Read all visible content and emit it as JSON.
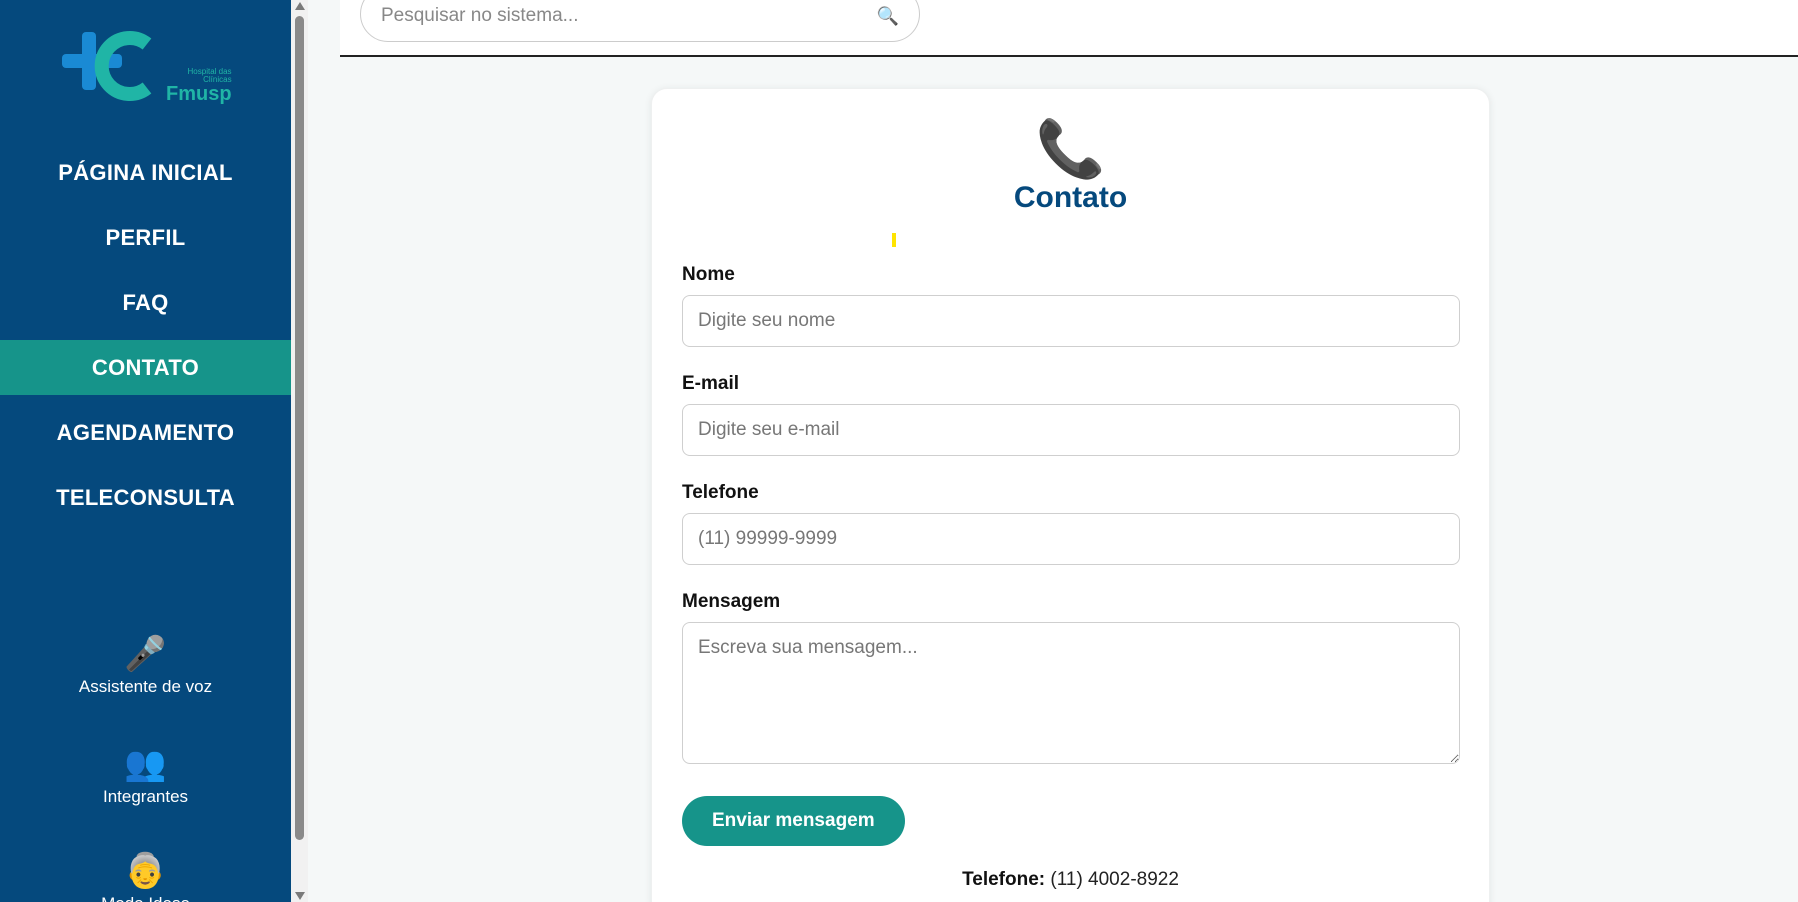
{
  "sidebar": {
    "logo": {
      "small": "Hospital das Clínicas",
      "big": "Fmusp"
    },
    "nav": [
      {
        "label": "PÁGINA INICIAL"
      },
      {
        "label": "PERFIL"
      },
      {
        "label": "FAQ"
      },
      {
        "label": "CONTATO",
        "active": true
      },
      {
        "label": "AGENDAMENTO"
      },
      {
        "label": "TELECONSULTA"
      }
    ],
    "tools": [
      {
        "icon": "microphone-icon",
        "label": "Assistente de voz"
      },
      {
        "icon": "people-icon",
        "label": "Integrantes"
      },
      {
        "icon": "elderly-person-icon",
        "label": "Modo Idoso"
      }
    ]
  },
  "search": {
    "placeholder": "Pesquisar no sistema..."
  },
  "card": {
    "title": "Contato",
    "fields": [
      {
        "label": "Nome",
        "placeholder": "Digite seu nome"
      },
      {
        "label": "E-mail",
        "placeholder": "Digite seu e-mail"
      },
      {
        "label": "Telefone",
        "placeholder": "(11) 99999-9999"
      },
      {
        "label": "Mensagem",
        "placeholder": "Escreva sua mensagem..."
      }
    ],
    "submit_label": "Enviar mensagem",
    "contact": {
      "phone_label": "Telefone:",
      "phone_value": "(11) 4002-8922"
    }
  },
  "colors": {
    "sidebar": "#05497d",
    "accent": "#16948a",
    "title": "#05497d",
    "phone_icon": "#e42f7f"
  }
}
